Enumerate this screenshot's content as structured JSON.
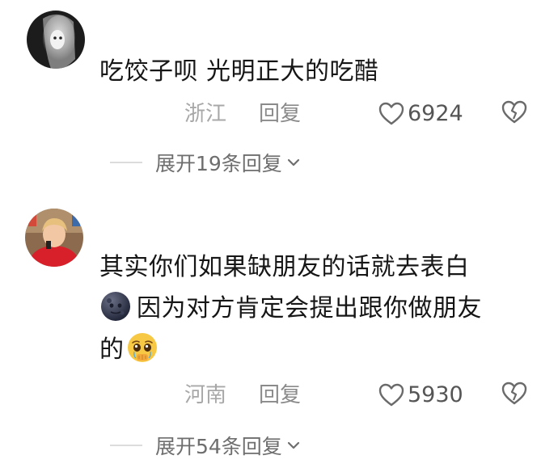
{
  "comments": [
    {
      "text": "吃饺子呗 光明正大的吃醋",
      "location": "浙江",
      "reply_label": "回复",
      "likes": "6924",
      "expand_label": "展开19条回复"
    },
    {
      "text_line1": "其实你们如果缺朋友的话就去表白",
      "text_line2": "因为对方肯定会提出跟你做朋友",
      "text_line3": "的",
      "emoji_1": "new-moon-face-emoji",
      "emoji_2": "pleading-face-emoji",
      "location": "河南",
      "reply_label": "回复",
      "likes": "5930",
      "expand_label": "展开54条回复"
    }
  ],
  "colors": {
    "text": "#161616",
    "meta": "#a8a8a8",
    "divider": "#dcdcdc"
  }
}
